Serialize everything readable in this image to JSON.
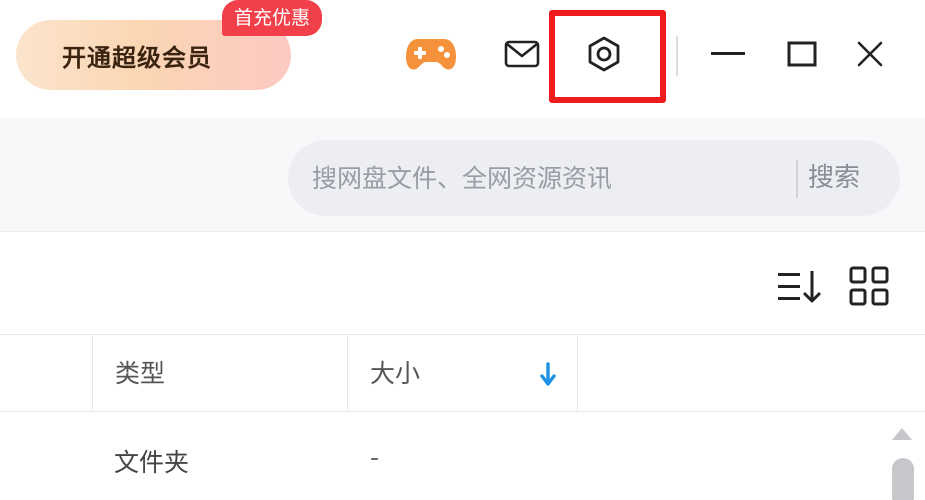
{
  "titlebar": {
    "vip_label": "开通超级会员",
    "promo_badge": "首充优惠",
    "icons": [
      "game-controller-icon",
      "mail-icon",
      "settings-gear-icon",
      "minimize-icon",
      "maximize-icon",
      "close-icon"
    ],
    "accent_colors": {
      "game": "#f6923b",
      "highlight": "#ee1c1c",
      "badge": "#f2404a"
    }
  },
  "search": {
    "placeholder": "搜网盘文件、全网资源资讯",
    "value": "",
    "button_label": "搜索"
  },
  "toolbar": {
    "icons": [
      "sort-list-icon",
      "grid-view-icon"
    ]
  },
  "table": {
    "columns": [
      {
        "key": "type",
        "label": "类型"
      },
      {
        "key": "size",
        "label": "大小",
        "sorted": "descending"
      }
    ],
    "rows": [
      {
        "type": "文件夹",
        "size": "-"
      }
    ]
  }
}
